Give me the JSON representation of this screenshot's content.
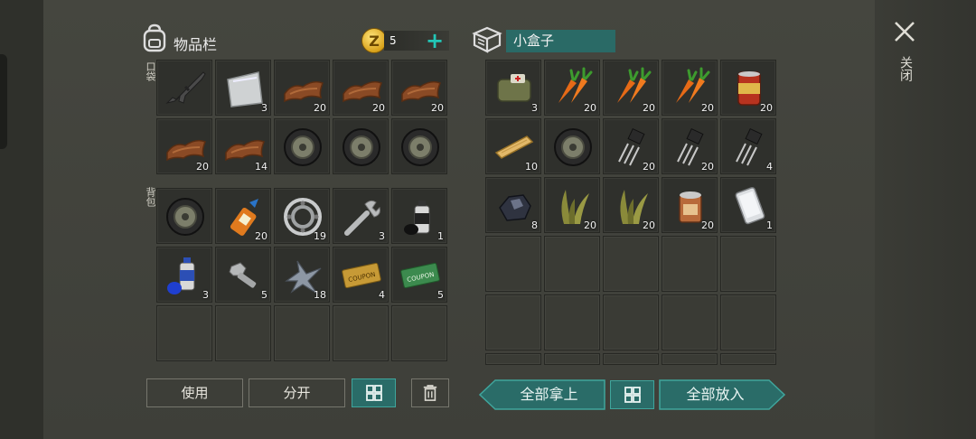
{
  "inventory": {
    "title": "物品栏",
    "coins": "5",
    "coin_symbol": "Z",
    "pocket_label": "口袋",
    "backpack_label": "背包",
    "pocket_slots": [
      {
        "icon": "rifle-icon",
        "qty": ""
      },
      {
        "icon": "metal-sheet-icon",
        "qty": "3"
      },
      {
        "icon": "leather-icon",
        "qty": "20"
      },
      {
        "icon": "leather-icon",
        "qty": "20"
      },
      {
        "icon": "leather-icon",
        "qty": "20"
      },
      {
        "icon": "leather-icon",
        "qty": "20"
      },
      {
        "icon": "leather-icon",
        "qty": "14"
      },
      {
        "icon": "tire-icon",
        "qty": ""
      },
      {
        "icon": "tire-icon",
        "qty": ""
      },
      {
        "icon": "tire-icon",
        "qty": ""
      }
    ],
    "backpack_slots": [
      {
        "icon": "tire-icon",
        "qty": ""
      },
      {
        "icon": "glue-icon",
        "qty": "20"
      },
      {
        "icon": "bearing-icon",
        "qty": "19"
      },
      {
        "icon": "wrench-icon",
        "qty": "3"
      },
      {
        "icon": "spray-can-black-icon",
        "qty": "1"
      },
      {
        "icon": "spray-can-blue-icon",
        "qty": "3"
      },
      {
        "icon": "bolt-icon",
        "qty": "5"
      },
      {
        "icon": "scrap-metal-icon",
        "qty": "18"
      },
      {
        "icon": "coupon-gold-icon",
        "qty": "4"
      },
      {
        "icon": "coupon-green-icon",
        "qty": "5"
      },
      {
        "icon": "",
        "qty": ""
      },
      {
        "icon": "",
        "qty": ""
      },
      {
        "icon": "",
        "qty": ""
      },
      {
        "icon": "",
        "qty": ""
      },
      {
        "icon": "",
        "qty": ""
      }
    ],
    "buttons": {
      "use": "使用",
      "split": "分开"
    }
  },
  "container": {
    "title": "小盒子",
    "slots": [
      {
        "icon": "first-aid-bag-icon",
        "qty": "3"
      },
      {
        "icon": "carrot-icon",
        "qty": "20"
      },
      {
        "icon": "carrot-icon",
        "qty": "20"
      },
      {
        "icon": "carrot-icon",
        "qty": "20"
      },
      {
        "icon": "canned-food-icon",
        "qty": "20"
      },
      {
        "icon": "wood-plank-icon",
        "qty": "10"
      },
      {
        "icon": "tire-icon",
        "qty": ""
      },
      {
        "icon": "transistor-icon",
        "qty": "20"
      },
      {
        "icon": "transistor-icon",
        "qty": "20"
      },
      {
        "icon": "transistor-icon",
        "qty": "4"
      },
      {
        "icon": "coal-icon",
        "qty": "8"
      },
      {
        "icon": "plant-fiber-icon",
        "qty": "20"
      },
      {
        "icon": "plant-fiber-icon",
        "qty": "20"
      },
      {
        "icon": "open-can-icon",
        "qty": "20"
      },
      {
        "icon": "phone-icon",
        "qty": "1"
      }
    ],
    "buttons": {
      "take_all": "全部拿上",
      "put_all": "全部放入"
    }
  },
  "close_label": "关闭",
  "colors": {
    "accent": "#2a6c68",
    "accent_border": "#3fa59c",
    "plus": "#22c7b7"
  }
}
